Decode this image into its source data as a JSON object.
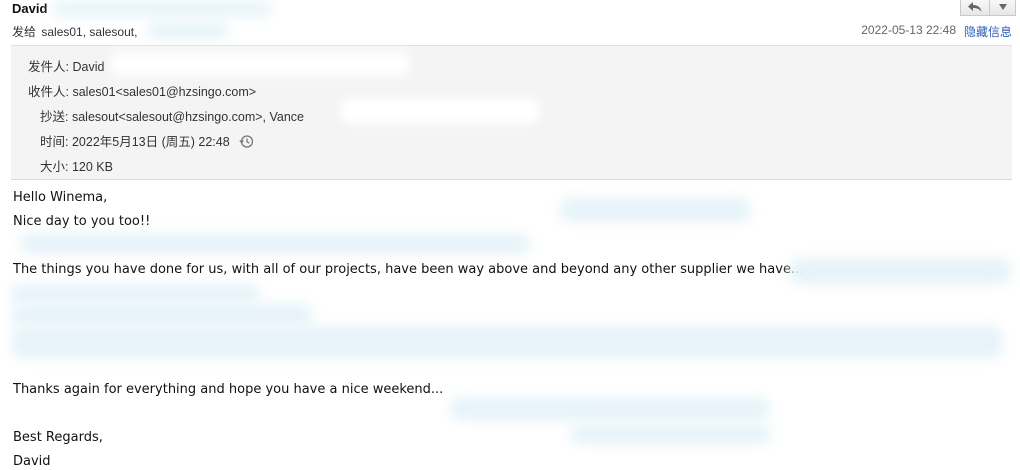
{
  "header": {
    "sender_name": "David",
    "to_label": "发给",
    "to_value": "sales01, salesout,",
    "date": "2022-05-13 22:48",
    "hide_details": "隐藏信息"
  },
  "toolbar": {
    "reply_icon": "reply-arrow-icon",
    "dropdown_icon": "chevron-down-icon"
  },
  "details": {
    "from_label": "发件人:",
    "from_value": "David",
    "to_label": "收件人:",
    "to_value": "sales01<sales01@hzsingo.com>",
    "cc_label": "抄送:",
    "cc_value": "salesout<salesout@hzsingo.com>,  Vance",
    "time_label": "时间:",
    "time_value": "2022年5月13日 (周五) 22:48",
    "size_label": "大小:",
    "size_value": "120 KB"
  },
  "body": {
    "greeting": "Hello Winema,",
    "line1": "Nice day to you too!!",
    "line2": "The things you have done for us, with all of our projects, have been way above and beyond any other supplier we have...",
    "line3": "Thanks again for everything and hope you have a nice weekend...",
    "closing": "Best Regards,",
    "signature": "David"
  }
}
